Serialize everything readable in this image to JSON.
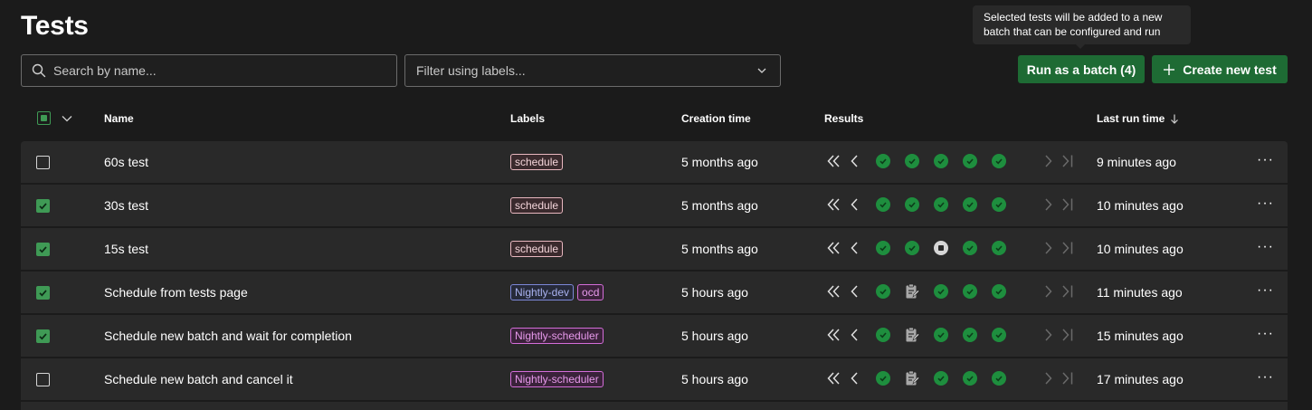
{
  "page": {
    "title": "Tests",
    "tooltip": {
      "line1": "Selected tests will be added to a new",
      "line2": "batch that can be configured and run"
    }
  },
  "toolbar": {
    "search_placeholder": "Search by name...",
    "filter_placeholder": "Filter using labels...",
    "run_batch_label": "Run as a batch (4)",
    "create_label": "Create new test"
  },
  "table": {
    "columns": {
      "name": "Name",
      "labels": "Labels",
      "creation_time": "Creation time",
      "results": "Results",
      "last_run_time": "Last run time"
    },
    "sort": {
      "column": "last_run_time",
      "direction": "descending"
    },
    "rows": [
      {
        "checked": false,
        "name": "60s test",
        "labels": [
          {
            "text": "schedule",
            "color": "pink"
          }
        ],
        "creation_time": "5 months ago",
        "results": [
          "passed",
          "passed",
          "passed",
          "passed",
          "passed"
        ],
        "last_run_time": "9 minutes ago"
      },
      {
        "checked": true,
        "name": "30s test",
        "labels": [
          {
            "text": "schedule",
            "color": "pink"
          }
        ],
        "creation_time": "5 months ago",
        "results": [
          "passed",
          "passed",
          "passed",
          "passed",
          "passed"
        ],
        "last_run_time": "10 minutes ago"
      },
      {
        "checked": true,
        "name": "15s test",
        "labels": [
          {
            "text": "schedule",
            "color": "pink"
          }
        ],
        "creation_time": "5 months ago",
        "results": [
          "passed",
          "passed",
          "stopped",
          "passed",
          "passed"
        ],
        "last_run_time": "10 minutes ago"
      },
      {
        "checked": true,
        "name": "Schedule from tests page",
        "labels": [
          {
            "text": "Nightly-dev",
            "color": "blue"
          },
          {
            "text": "ocd",
            "color": "magenta"
          }
        ],
        "creation_time": "5 hours ago",
        "results": [
          "passed",
          "draft",
          "passed",
          "passed",
          "passed"
        ],
        "last_run_time": "11 minutes ago"
      },
      {
        "checked": true,
        "name": "Schedule new batch and wait for completion",
        "labels": [
          {
            "text": "Nightly-scheduler",
            "color": "magenta"
          }
        ],
        "creation_time": "5 hours ago",
        "results": [
          "passed",
          "draft",
          "passed",
          "passed",
          "passed"
        ],
        "last_run_time": "15 minutes ago"
      },
      {
        "checked": false,
        "name": "Schedule new batch and cancel it",
        "labels": [
          {
            "text": "Nightly-scheduler",
            "color": "magenta"
          }
        ],
        "creation_time": "5 hours ago",
        "results": [
          "passed",
          "draft",
          "passed",
          "passed",
          "passed"
        ],
        "last_run_time": "17 minutes ago"
      }
    ]
  },
  "icons": {
    "search": "search-icon",
    "filter_dropdown": "chevron-down-icon",
    "create": "plus-icon",
    "select_all_menu": "chevron-down-icon",
    "sort": "arrow-down-icon",
    "first_page": "double-chevron-left-icon",
    "prev": "chevron-left-icon",
    "next": "chevron-right-icon",
    "last": "last-page-icon",
    "passed": "check-circle-icon",
    "stopped": "stop-circle-icon",
    "draft": "clipboard-edit-icon",
    "more": "more-horizontal-icon"
  },
  "colors": {
    "accent_green": "#1e6b34",
    "passed_green": "#1e8e3e",
    "checkbox_green": "#3f9a55",
    "row_bg": "#292929",
    "page_bg": "#1b1b1b"
  }
}
